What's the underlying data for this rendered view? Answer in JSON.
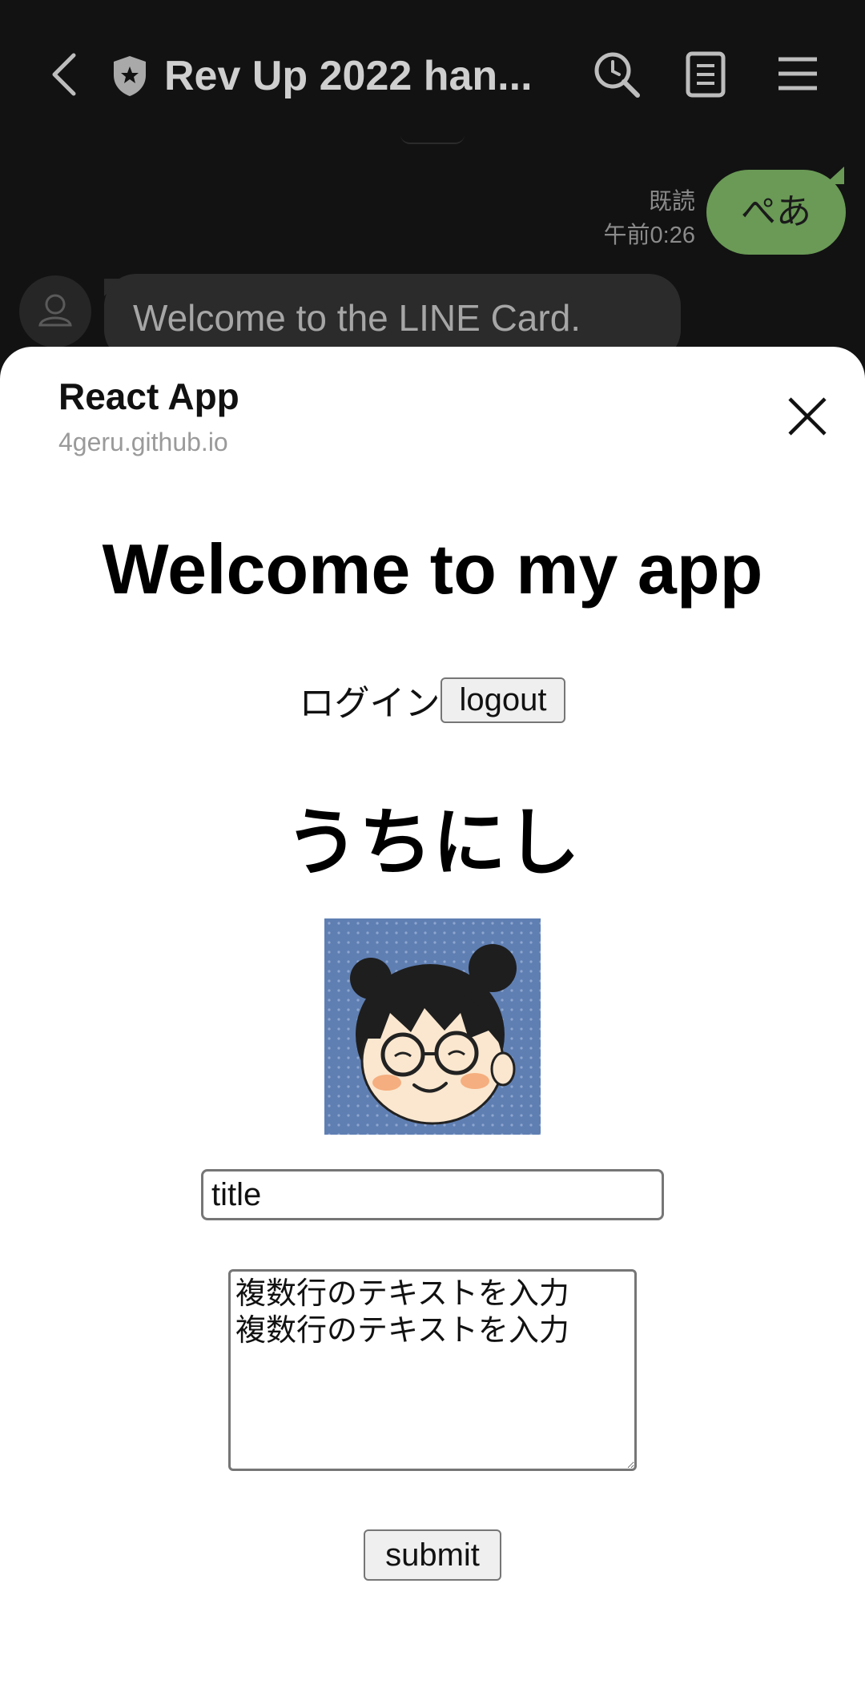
{
  "header": {
    "chat_title": "Rev Up 2022 han...",
    "icons": [
      "back-arrow-icon",
      "shield-icon",
      "search-icon",
      "notes-icon",
      "menu-icon"
    ]
  },
  "chat": {
    "sent_message": {
      "read_label": "既読",
      "time": "午前0:26",
      "text": "ぺあ",
      "color": "#6a9a56"
    },
    "received_message": {
      "text": "Welcome to the LINE Card."
    }
  },
  "sheet": {
    "app_name": "React App",
    "url": "4geru.github.io",
    "close_icon": "close-icon"
  },
  "app": {
    "heading": "Welcome to my app",
    "login_text": "ログイン",
    "logout_label": "logout",
    "user_name": "うちにし",
    "title_value": "title",
    "textarea_value": "複数行のテキストを入力\n複数行のテキストを入力",
    "submit_label": "submit"
  }
}
